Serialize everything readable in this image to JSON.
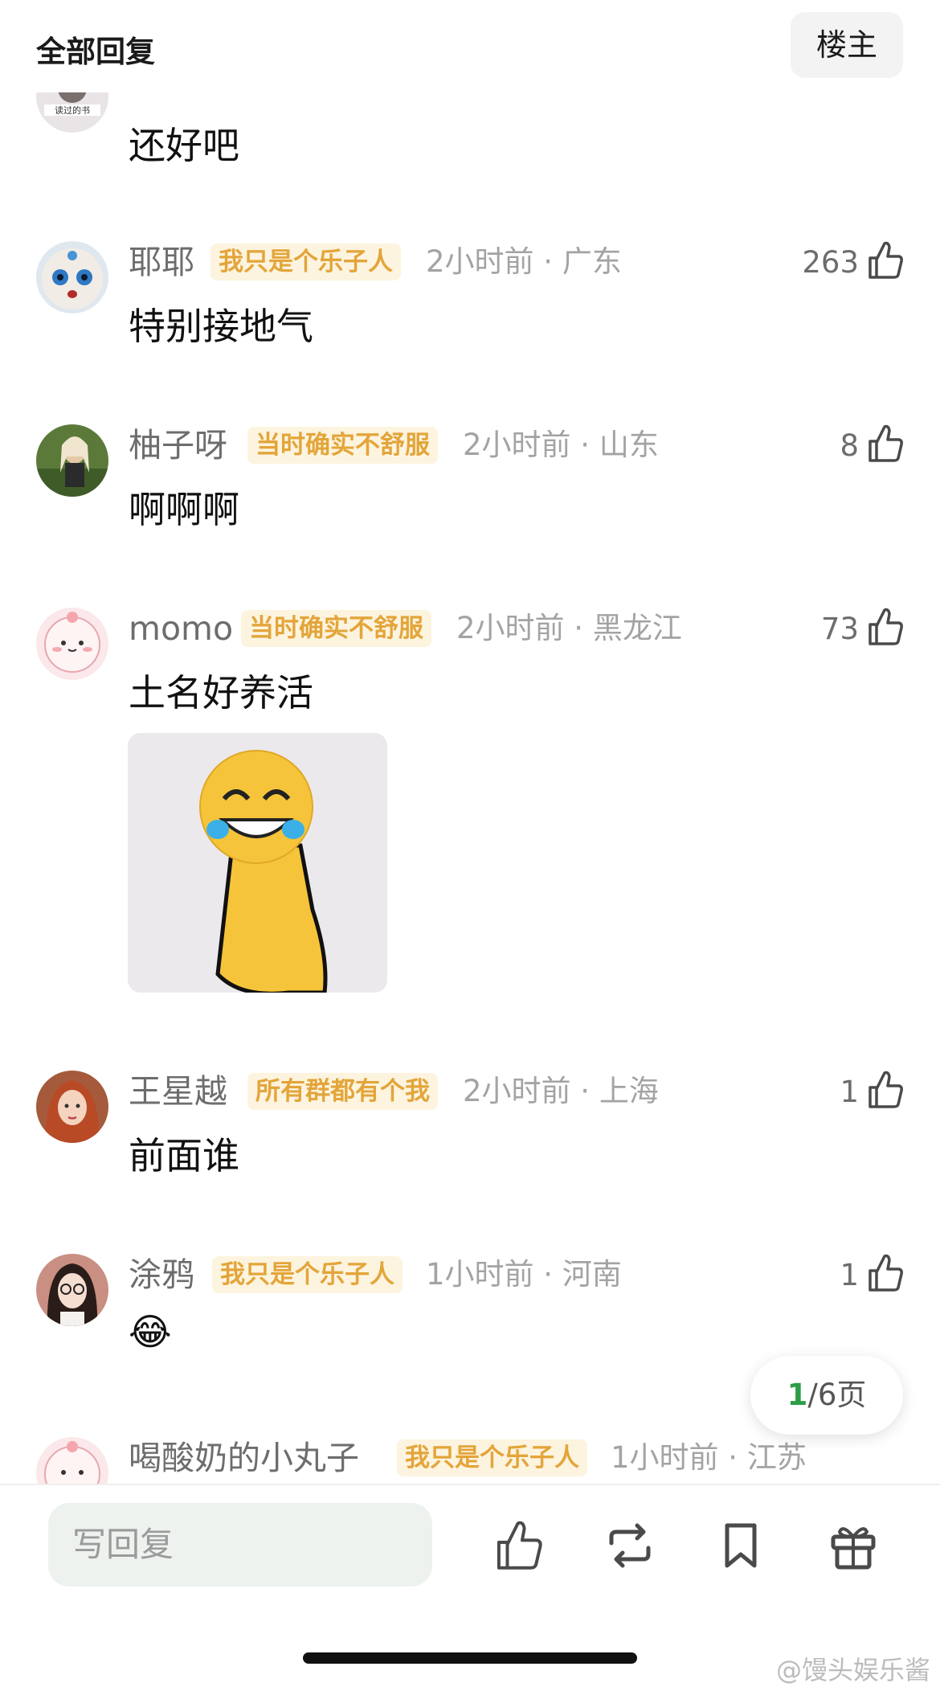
{
  "header": {
    "title": "全部回复",
    "owner_button": "楼主"
  },
  "comments": [
    {
      "text": "还好吧"
    },
    {
      "name": "耶耶",
      "badge": "我只是个乐子人",
      "meta": "2小时前 · 广东",
      "likes": "263",
      "text": "特别接地气"
    },
    {
      "name": "柚子呀",
      "badge": "当时确实不舒服",
      "meta": "2小时前 · 山东",
      "likes": "8",
      "text": "啊啊啊"
    },
    {
      "name": "momo",
      "badge": "当时确实不舒服",
      "meta": "2小时前 · 黑龙江",
      "likes": "73",
      "text": "土名好养活"
    },
    {
      "name": "王星越",
      "badge": "所有群都有个我",
      "meta": "2小时前 · 上海",
      "likes": "1",
      "text": "前面谁"
    },
    {
      "name": "涂鸦",
      "badge": "我只是个乐子人",
      "meta": "1小时前 · 河南",
      "likes": "1",
      "text": "😂"
    },
    {
      "name": "喝酸奶的小丸子",
      "badge": "我只是个乐子人",
      "meta": "1小时前 · 江苏"
    }
  ],
  "pager": {
    "current": "1",
    "total_label": "/6页"
  },
  "bottom_bar": {
    "reply_placeholder": "写回复"
  },
  "watermark": "@馒头娱乐酱",
  "icons": [
    "thumb-up-icon",
    "repost-icon",
    "bookmark-icon",
    "gift-icon"
  ],
  "colors": {
    "badge_bg": "#fdf4df",
    "badge_text": "#e3a53a",
    "pager_accent": "#2e9c46",
    "input_bg": "#eef2ef"
  }
}
